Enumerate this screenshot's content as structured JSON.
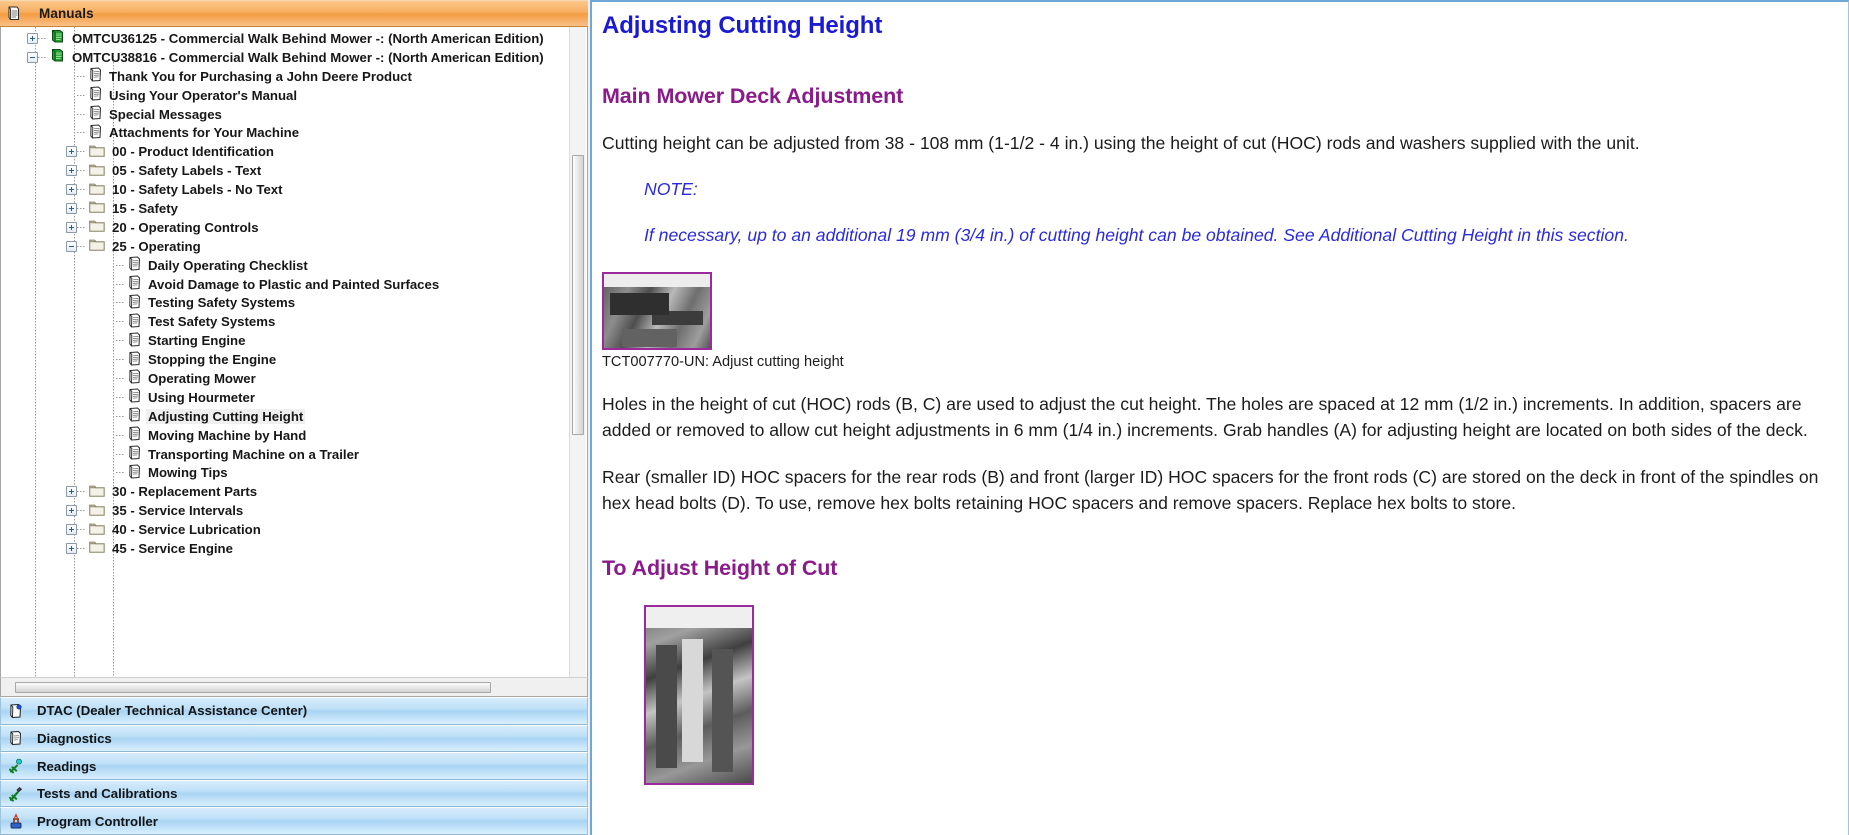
{
  "left_panel": {
    "accordion_header": {
      "label": "Manuals",
      "icon": "manual-book-icon"
    },
    "tree": [
      {
        "label": "OMTCU36125 - Commercial Walk Behind Mower -: (North American Edition)",
        "depth": 1,
        "expander": "plus",
        "icon": "green-book-icon",
        "selected": false
      },
      {
        "label": "OMTCU38816 - Commercial Walk Behind Mower -: (North American Edition)",
        "depth": 1,
        "expander": "minus",
        "icon": "green-book-icon",
        "selected": false
      },
      {
        "label": "Thank You for Purchasing a John Deere Product",
        "depth": 2,
        "expander": "none",
        "icon": "document-icon",
        "selected": false
      },
      {
        "label": "Using Your Operator's Manual",
        "depth": 2,
        "expander": "none",
        "icon": "document-icon",
        "selected": false
      },
      {
        "label": "Special Messages",
        "depth": 2,
        "expander": "none",
        "icon": "document-icon",
        "selected": false
      },
      {
        "label": "Attachments for Your Machine",
        "depth": 2,
        "expander": "none",
        "icon": "document-icon",
        "selected": false
      },
      {
        "label": "00 - Product Identification",
        "depth": 2,
        "expander": "plus",
        "icon": "folder-icon",
        "selected": false
      },
      {
        "label": "05 - Safety Labels - Text",
        "depth": 2,
        "expander": "plus",
        "icon": "folder-icon",
        "selected": false
      },
      {
        "label": "10 - Safety Labels - No Text",
        "depth": 2,
        "expander": "plus",
        "icon": "folder-icon",
        "selected": false
      },
      {
        "label": "15 - Safety",
        "depth": 2,
        "expander": "plus",
        "icon": "folder-icon",
        "selected": false
      },
      {
        "label": "20 - Operating Controls",
        "depth": 2,
        "expander": "plus",
        "icon": "folder-icon",
        "selected": false
      },
      {
        "label": "25 - Operating",
        "depth": 2,
        "expander": "minus",
        "icon": "folder-icon",
        "selected": false
      },
      {
        "label": "Daily Operating Checklist",
        "depth": 3,
        "expander": "none",
        "icon": "document-icon",
        "selected": false
      },
      {
        "label": "Avoid Damage to Plastic and Painted Surfaces",
        "depth": 3,
        "expander": "none",
        "icon": "document-icon",
        "selected": false
      },
      {
        "label": "Testing Safety Systems",
        "depth": 3,
        "expander": "none",
        "icon": "document-icon",
        "selected": false
      },
      {
        "label": "Test Safety Systems",
        "depth": 3,
        "expander": "none",
        "icon": "document-icon",
        "selected": false
      },
      {
        "label": "Starting Engine",
        "depth": 3,
        "expander": "none",
        "icon": "document-icon",
        "selected": false
      },
      {
        "label": "Stopping the Engine",
        "depth": 3,
        "expander": "none",
        "icon": "document-icon",
        "selected": false
      },
      {
        "label": "Operating Mower",
        "depth": 3,
        "expander": "none",
        "icon": "document-icon",
        "selected": false
      },
      {
        "label": "Using Hourmeter",
        "depth": 3,
        "expander": "none",
        "icon": "document-icon",
        "selected": false
      },
      {
        "label": "Adjusting Cutting Height",
        "depth": 3,
        "expander": "none",
        "icon": "document-icon",
        "selected": true
      },
      {
        "label": "Moving Machine by Hand",
        "depth": 3,
        "expander": "none",
        "icon": "document-icon",
        "selected": false
      },
      {
        "label": "Transporting Machine on a Trailer",
        "depth": 3,
        "expander": "none",
        "icon": "document-icon",
        "selected": false
      },
      {
        "label": "Mowing Tips",
        "depth": 3,
        "expander": "none",
        "icon": "document-icon",
        "selected": false
      },
      {
        "label": "30 - Replacement Parts",
        "depth": 2,
        "expander": "plus",
        "icon": "folder-icon",
        "selected": false
      },
      {
        "label": "35 - Service Intervals",
        "depth": 2,
        "expander": "plus",
        "icon": "folder-icon",
        "selected": false
      },
      {
        "label": "40 - Service Lubrication",
        "depth": 2,
        "expander": "plus",
        "icon": "folder-icon",
        "selected": false
      },
      {
        "label": "45 - Service Engine",
        "depth": 2,
        "expander": "plus",
        "icon": "folder-icon",
        "selected": false
      }
    ],
    "nav_items": [
      {
        "label": "DTAC (Dealer Technical Assistance Center)",
        "icon": "manual-book-icon"
      },
      {
        "label": "Diagnostics",
        "icon": "diagnostics-page-icon"
      },
      {
        "label": "Readings",
        "icon": "readings-plug-icon"
      },
      {
        "label": "Tests and Calibrations",
        "icon": "tests-wrench-icon"
      },
      {
        "label": "Program Controller",
        "icon": "program-controller-icon"
      }
    ]
  },
  "content": {
    "title": "Adjusting Cutting Height",
    "section1_heading": "Main Mower Deck Adjustment",
    "para1": "Cutting height can be adjusted from 38 - 108 mm (1-1/2 - 4 in.) using the height of cut (HOC) rods and washers supplied with the unit.",
    "note_label": "NOTE:",
    "note_text": "If necessary, up to an additional 19 mm (3/4 in.) of cutting height can be obtained. See Additional Cutting Height in this section.",
    "figure1_caption": "TCT007770-UN: Adjust cutting height",
    "para2": "Holes in the height of cut (HOC) rods (B, C) are used to adjust the cut height. The holes are spaced at 12 mm (1/2 in.) increments. In addition, spacers are added or removed to allow cut height adjustments in 6 mm (1/4 in.) increments. Grab handles (A) for adjusting height are located on both sides of the deck.",
    "para3": "Rear (smaller ID) HOC spacers for the rear rods (B) and front (larger ID) HOC spacers for the front rods (C) are stored on the deck in front of the spindles on hex head bolts (D). To use, remove hex bolts retaining HOC spacers and remove spacers. Replace hex bolts to store.",
    "section2_heading": "To Adjust Height of Cut"
  },
  "colors": {
    "accordion_orange": "#f39c42",
    "nav_blue": "#a9d4f3",
    "title_blue": "#1a1ad2",
    "heading_purple": "#8b1a8b",
    "note_blue": "#2a2ae0",
    "figure_border": "#9b2a9b"
  }
}
